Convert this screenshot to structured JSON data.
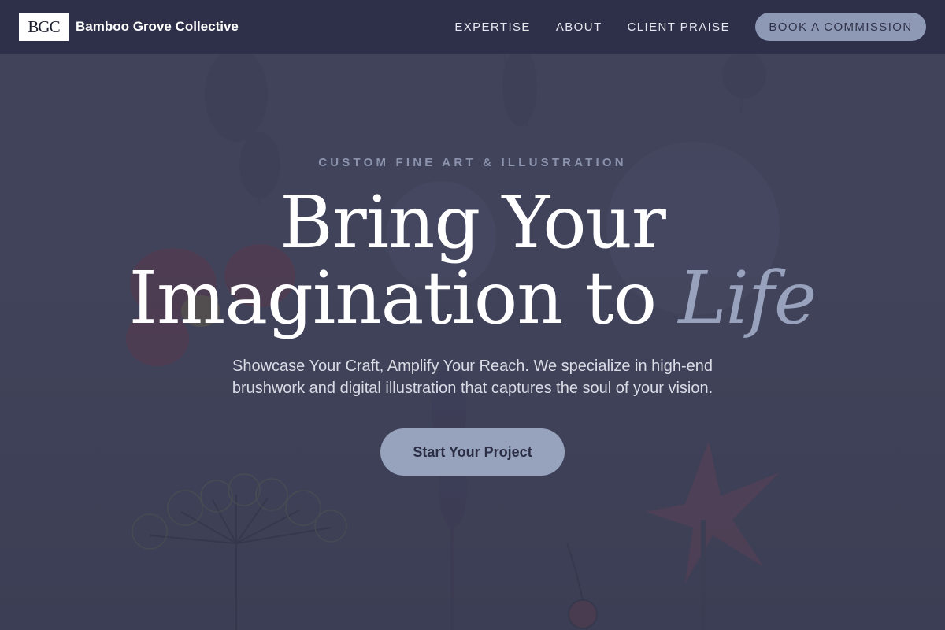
{
  "header": {
    "logo_text": "BGC",
    "brand_name": "Bamboo Grove Collective",
    "nav": [
      {
        "label": "EXPERTISE"
      },
      {
        "label": "ABOUT"
      },
      {
        "label": "CLIENT PRAISE"
      }
    ],
    "cta_label": "BOOK A COMMISSION"
  },
  "hero": {
    "eyebrow": "CUSTOM FINE ART & ILLUSTRATION",
    "headline_line1": "Bring Your",
    "headline_line2_plain": "Imagination to",
    "headline_line2_accent": "Life",
    "subcopy": "Showcase Your Craft, Amplify Your Reach. We specialize in high-end brushwork and digital illustration that captures the soul of your vision.",
    "cta_label": "Start Your Project"
  },
  "colors": {
    "header_bg": "#2e304a",
    "page_bg": "#3f4158",
    "accent": "#8e99b6",
    "headline_accent": "#98a2bd",
    "eyebrow": "#8b93ad"
  }
}
